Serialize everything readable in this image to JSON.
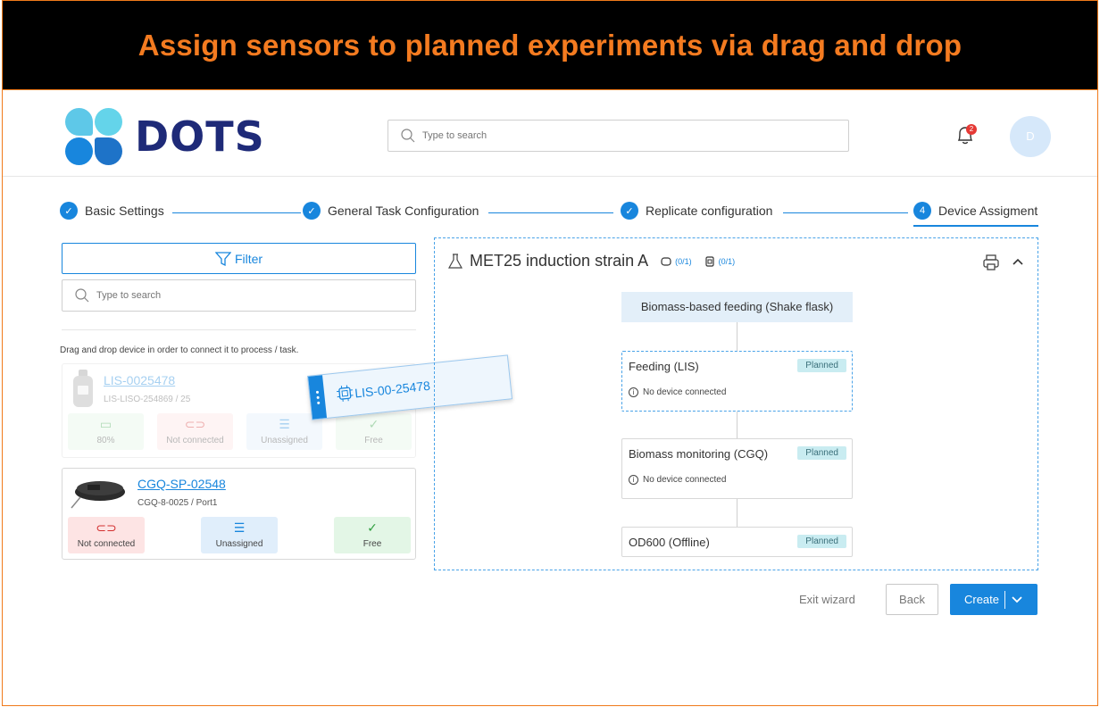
{
  "banner": {
    "title": "Assign sensors to planned experiments via drag and drop"
  },
  "header": {
    "logo_text": "DOTS",
    "search_placeholder": "Type to search",
    "notification_count": "2",
    "avatar_initial": "D",
    "logo_colors": [
      "#5ec8e8",
      "#1886dd",
      "#1e73c8",
      "#64d4ea"
    ]
  },
  "stepper": {
    "steps": [
      {
        "label": "Basic Settings",
        "state": "done"
      },
      {
        "label": "General Task Configuration",
        "state": "done"
      },
      {
        "label": "Replicate configuration",
        "state": "done"
      },
      {
        "label": "Device Assigment",
        "state": "active",
        "number": "4"
      }
    ]
  },
  "sidebar": {
    "filter_label": "Filter",
    "search_placeholder": "Type to search",
    "hint": "Drag and drop device in order to connect it to process / task.",
    "devices": [
      {
        "title": "LIS-0025478",
        "subtitle": "LIS-LISO-254869 / 25",
        "status": [
          {
            "label": "80%",
            "kind": "battery"
          },
          {
            "label": "Not connected",
            "kind": "link"
          },
          {
            "label": "Unassigned",
            "kind": "list"
          },
          {
            "label": "Free",
            "kind": "check"
          }
        ]
      },
      {
        "title": "CGQ-SP-02548",
        "subtitle": "CGQ-8-0025 / Port1",
        "status": [
          {
            "label": "Not connected",
            "kind": "link"
          },
          {
            "label": "Unassigned",
            "kind": "list"
          },
          {
            "label": "Free",
            "kind": "check"
          }
        ]
      }
    ]
  },
  "drag_chip": {
    "label": "LIS-00-25478",
    "icon": "chip-icon"
  },
  "experiment": {
    "title": "MET25 induction strain A",
    "counter_a": "(0/1)",
    "counter_b": "(0/1)",
    "head_node": "Biomass-based feeding (Shake flask)",
    "nodes": [
      {
        "label": "Feeding (LIS)",
        "badge": "Planned",
        "info": "No device connected"
      },
      {
        "label": "Biomass monitoring (CGQ)",
        "badge": "Planned",
        "info": "No device connected"
      },
      {
        "label": "OD600 (Offline)",
        "badge": "Planned"
      }
    ]
  },
  "actions": {
    "exit": "Exit wizard",
    "back": "Back",
    "create": "Create"
  },
  "colors": {
    "accent": "#1886dd",
    "banner_text": "#f47b20",
    "badge": "#c9ecf1"
  }
}
